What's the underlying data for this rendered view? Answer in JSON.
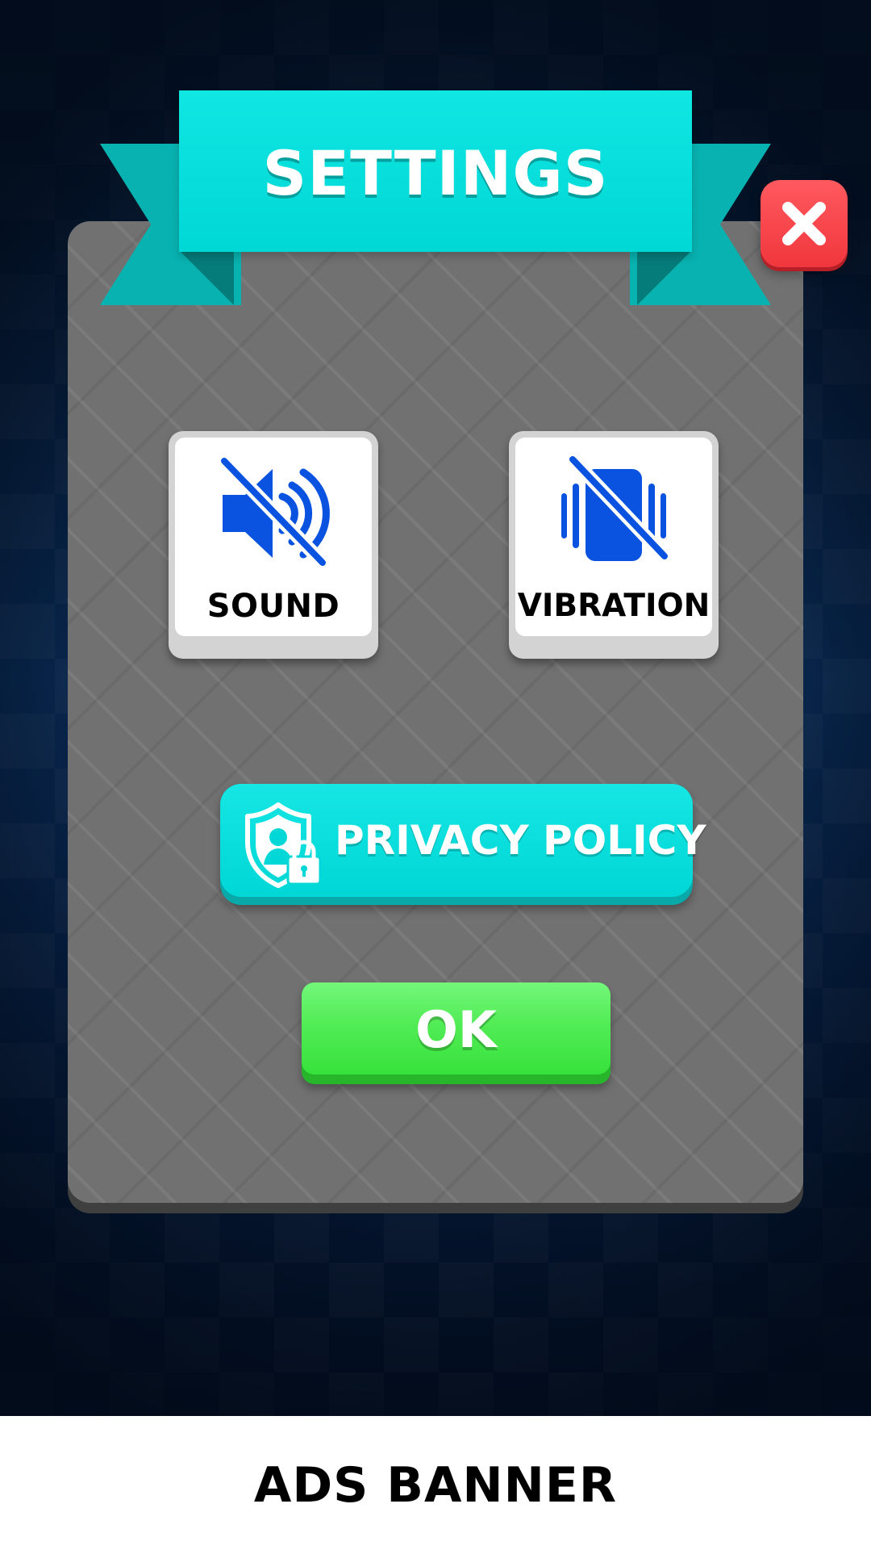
{
  "settings_dialog": {
    "title": "SETTINGS",
    "close_icon": "close-x-icon",
    "toggles": [
      {
        "label": "SOUND",
        "state": "off",
        "icon": "sound-muted-icon"
      },
      {
        "label": "VIBRATION",
        "state": "off",
        "icon": "vibration-off-icon"
      }
    ],
    "privacy_button": {
      "label": "PRIVACY POLICY",
      "icon": "shield-user-lock-icon"
    },
    "ok_button": {
      "label": "OK"
    }
  },
  "ads_banner": {
    "label": "ADS BANNER"
  },
  "colors": {
    "ribbon": "#00d8d6",
    "ribbon_dark": "#08b2b0",
    "panel": "#717171",
    "close_button": "#f0363d",
    "icon_blue": "#0a52e0",
    "ok_button": "#37e23b",
    "background": "#0b2a54"
  }
}
